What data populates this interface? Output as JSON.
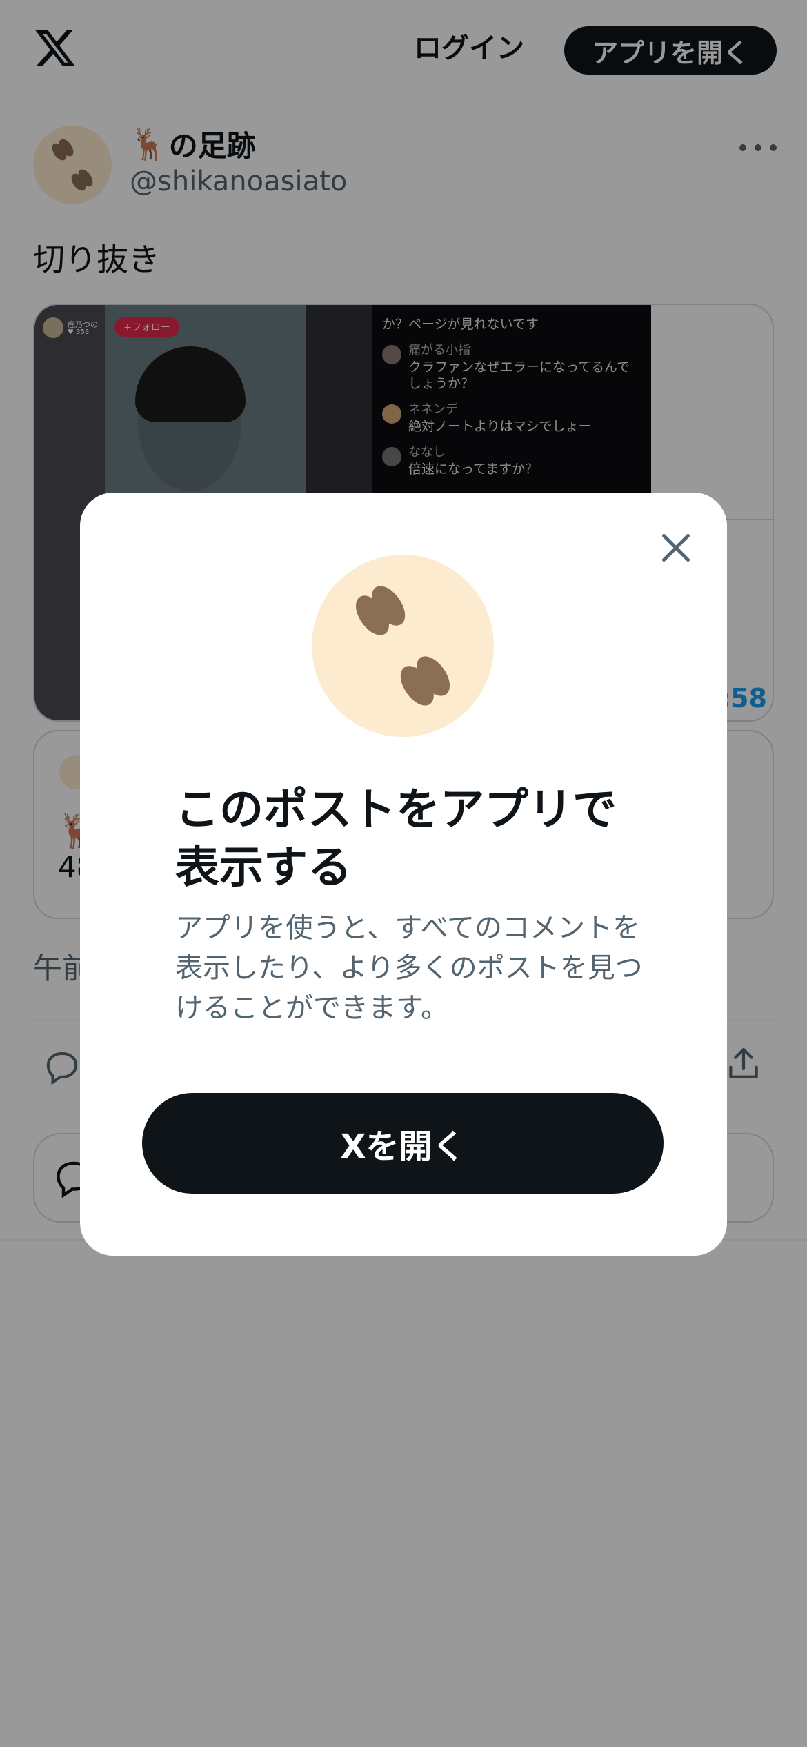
{
  "header": {
    "login_label": "ログイン",
    "open_app_label": "アプリを開く"
  },
  "tweet": {
    "display_name_emoji": "🦌",
    "display_name_text": "の足跡",
    "handle": "@shikanoasiato",
    "text": "切り抜き",
    "media": {
      "live_name": "鹿乃つの",
      "live_count": "♥ 358",
      "follow_label": "+フォロー",
      "time": ":58",
      "chat": [
        {
          "name": "",
          "text": "か？ページが見れないです"
        },
        {
          "name": "痛がる小指",
          "text": "クラファンなぜエラーになってるんでしょうか？"
        },
        {
          "name": "ネネンデ",
          "text": "絶対ノートよりはマシでしょー"
        },
        {
          "name": "ななし",
          "text": "倍速になってますか？"
        }
      ]
    },
    "quote": {
      "emoji": "🦌",
      "number_fragment": "48"
    },
    "timestamp_fragment": "午前"
  },
  "modal": {
    "title": "このポストをアプリで表示する",
    "description": "アプリを使うと、すべてのコメントを表示したり、より多くのポストを見つけることができます。",
    "button_label": "Xを開く"
  }
}
